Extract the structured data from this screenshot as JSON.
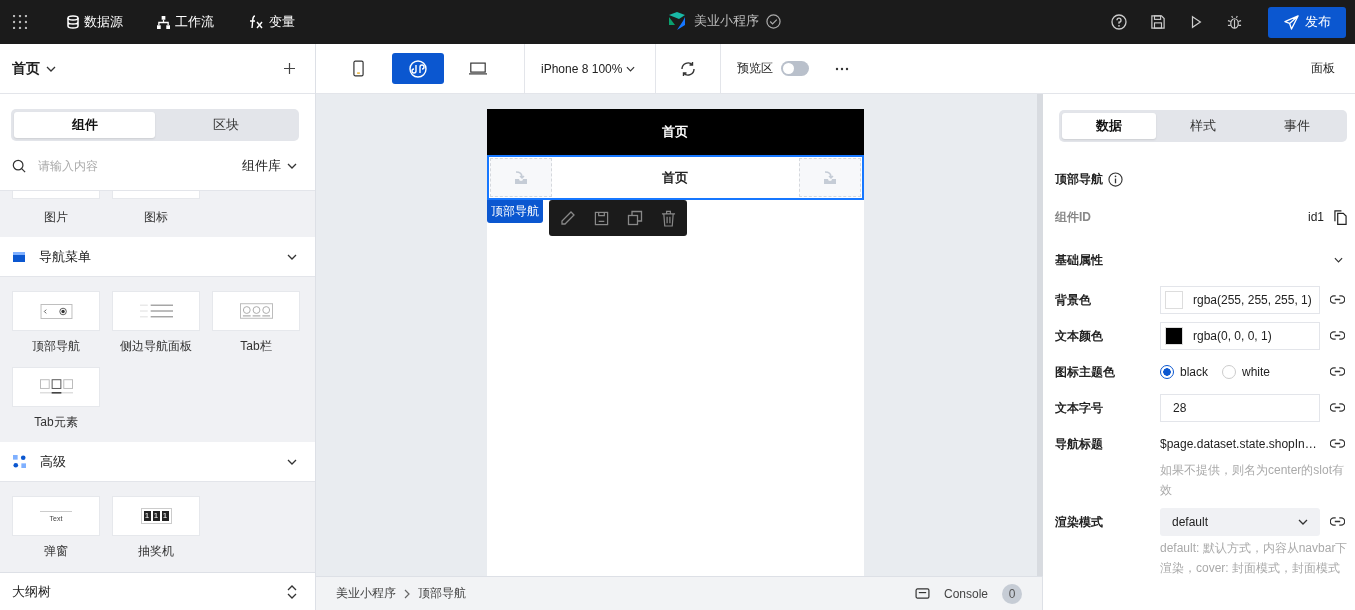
{
  "topbar": {
    "menus": [
      {
        "kind": "database",
        "label": "数据源"
      },
      {
        "kind": "workflow",
        "label": "工作流"
      },
      {
        "kind": "fx",
        "label": "变量"
      }
    ],
    "app_title": "美业小程序",
    "publish": "发布"
  },
  "page_header": {
    "title": "首页"
  },
  "left_tabs": [
    {
      "label": "组件",
      "selected": true
    },
    {
      "label": "区块",
      "selected": false
    }
  ],
  "search": {
    "placeholder": "请输入内容",
    "library": "组件库"
  },
  "partial_items": [
    {
      "label": "图片"
    },
    {
      "label": "图标"
    }
  ],
  "groups": [
    {
      "title": "导航菜单",
      "kind": "nav",
      "expanded": true,
      "items": [
        {
          "label": "顶部导航",
          "kind": "topnav"
        },
        {
          "label": "侧边导航面板",
          "kind": "sidenav"
        },
        {
          "label": "Tab栏",
          "kind": "tabbar"
        },
        {
          "label": "Tab元素",
          "kind": "tabitem"
        }
      ]
    },
    {
      "title": "高级",
      "kind": "advanced",
      "expanded": true,
      "items": [
        {
          "label": "弹窗",
          "kind": "popup",
          "preview_text": "Text"
        },
        {
          "label": "抽奖机",
          "kind": "lottery",
          "digits": [
            "1",
            "1",
            "1"
          ]
        }
      ]
    }
  ],
  "outline": {
    "title": "大纲树"
  },
  "toolbar": {
    "devices": [
      {
        "kind": "phone",
        "selected": false
      },
      {
        "kind": "miniprogram",
        "selected": true
      },
      {
        "kind": "desktop",
        "selected": false
      }
    ],
    "device_label": "iPhone 8 100%",
    "preview": {
      "label": "预览区",
      "on": false
    },
    "panel": "面板"
  },
  "canvas": {
    "status_title": "首页",
    "nav_title": "首页",
    "selection_label": "顶部导航"
  },
  "breadcrumb": [
    "美业小程序",
    "顶部导航"
  ],
  "console": {
    "label": "Console",
    "count": "0"
  },
  "inspector": {
    "tabs": [
      {
        "label": "数据",
        "selected": true
      },
      {
        "label": "样式",
        "selected": false
      },
      {
        "label": "事件",
        "selected": false
      }
    ],
    "component": "顶部导航",
    "id_label": "组件ID",
    "id": "id1",
    "section": "基础属性",
    "section_expanded": true,
    "props": [
      {
        "kind": "color",
        "label": "背景色",
        "value": "rgba(255, 255, 255, 1)",
        "color": "#ffffff"
      },
      {
        "kind": "color",
        "label": "文本颜色",
        "value": "rgba(0, 0, 0, 1)",
        "color": "#000000"
      },
      {
        "kind": "radio",
        "label": "图标主题色",
        "options": [
          {
            "label": "black",
            "selected": true
          },
          {
            "label": "white",
            "selected": false
          }
        ]
      },
      {
        "kind": "input",
        "label": "文本字号",
        "value": "28"
      },
      {
        "kind": "text",
        "label": "导航标题",
        "value": "$page.dataset.state.shopIn…",
        "hint": "如果不提供，则名为center的slot有效"
      },
      {
        "kind": "select",
        "label": "渲染模式",
        "value": "default",
        "hint": "default: 默认方式，内容从navbar下渲染，cover: 封面模式，封面模式"
      }
    ]
  }
}
